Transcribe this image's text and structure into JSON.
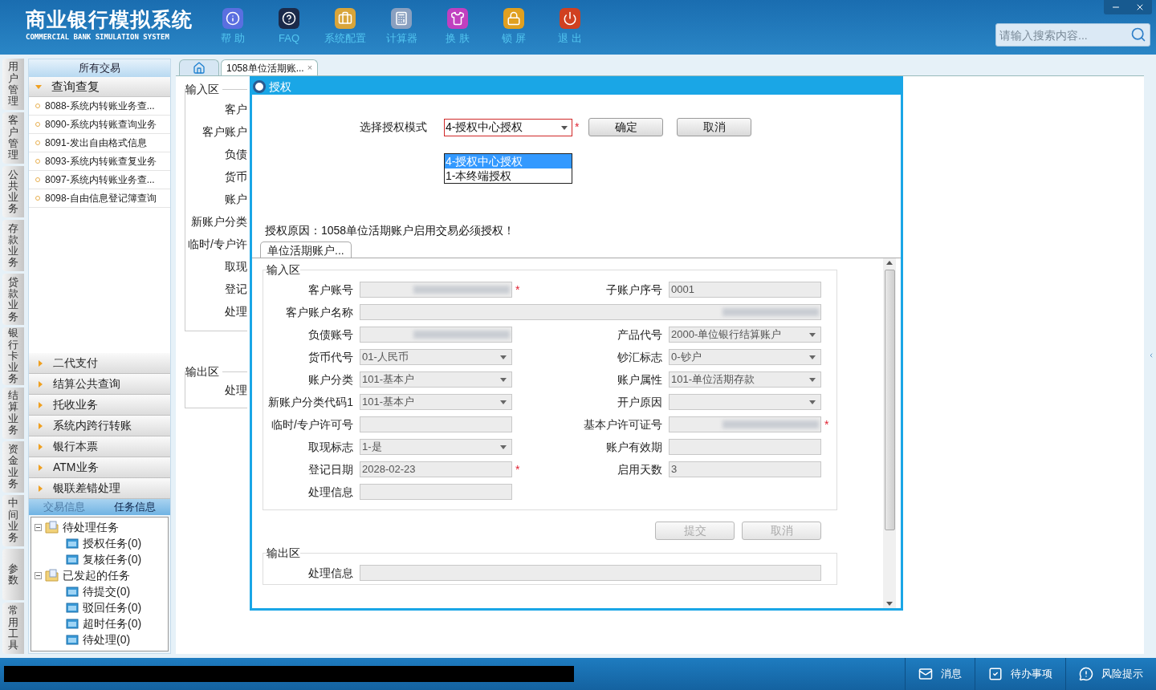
{
  "header": {
    "title": "商业银行模拟系统",
    "subtitle": "COMMERCIAL BANK SIMULATION SYSTEM",
    "toolbar": [
      {
        "kind": "help",
        "label": "帮 助"
      },
      {
        "kind": "faq",
        "label": "FAQ"
      },
      {
        "kind": "config",
        "label": "系统配置"
      },
      {
        "kind": "calculator",
        "label": "计算器"
      },
      {
        "kind": "skin",
        "label": "换 肤"
      },
      {
        "kind": "lock",
        "label": "锁 屏"
      },
      {
        "kind": "exit",
        "label": "退 出"
      }
    ],
    "search": {
      "placeholder": "请输入搜索内容..."
    }
  },
  "nav_tabs": [
    "用户管理",
    "客户管理",
    "公共业务",
    "存款业务",
    "贷款业务",
    "银行卡业务",
    "结算业务",
    "资金业务",
    "中间业务",
    "参数",
    "常用工具"
  ],
  "sidebar": {
    "title": "所有交易",
    "groups": [
      {
        "label": "查询查复",
        "expanded": true,
        "items": [
          "8088-系统内转账业务查...",
          "8090-系统内转账查询业务",
          "8091-发出自由格式信息",
          "8093-系统内转账查复业务",
          "8097-系统内转账业务查...",
          "8098-自由信息登记簿查询"
        ]
      },
      {
        "label": "二代支付",
        "expanded": false
      },
      {
        "label": "结算公共查询",
        "expanded": false
      },
      {
        "label": "托收业务",
        "expanded": false
      },
      {
        "label": "系统内跨行转账",
        "expanded": false
      },
      {
        "label": "银行本票",
        "expanded": false
      },
      {
        "label": "ATM业务",
        "expanded": false
      },
      {
        "label": "银联差错处理",
        "expanded": false
      }
    ],
    "bottom_tabs": [
      {
        "label": "交易信息",
        "selected": false
      },
      {
        "label": "任务信息",
        "selected": true
      }
    ],
    "tree": [
      {
        "label": "待处理任务",
        "expanded": true,
        "children": [
          {
            "label": "授权任务(0)"
          },
          {
            "label": "复核任务(0)"
          }
        ]
      },
      {
        "label": "已发起的任务",
        "expanded": true,
        "children": [
          {
            "label": "待提交(0)"
          },
          {
            "label": "驳回任务(0)"
          },
          {
            "label": "超时任务(0)"
          },
          {
            "label": "待处理(0)"
          }
        ]
      }
    ]
  },
  "tabs": [
    {
      "kind": "home",
      "selected": false
    },
    {
      "kind": "page",
      "label": "1058单位活期账...",
      "close": "×",
      "selected": true
    }
  ],
  "background_form": {
    "input_legend": "输入区",
    "input_labels": [
      "客户",
      "客户账户",
      "负债",
      "货币",
      "账户",
      "新账户分类",
      "临时/专户许",
      "取现",
      "登记",
      "处理"
    ],
    "output_legend": "输出区",
    "output_labels": [
      "处理"
    ]
  },
  "dialog": {
    "title": "授权",
    "mode_label": "选择授权模式",
    "mode_select": {
      "value": "4-授权中心授权",
      "mark": "*",
      "expanded": true,
      "options": [
        {
          "label": "4-授权中心授权",
          "selected": true
        },
        {
          "label": "1-本终端授权",
          "selected": false
        }
      ]
    },
    "buttons": [
      "确定",
      "取消"
    ],
    "reason": "授权原因：1058单位活期账户启用交易必须授权！",
    "tab": "单位活期账户...",
    "input_legend": "输入区",
    "rows": [
      {
        "left": {
          "label": "客户账号",
          "kind": "text",
          "blurred": true,
          "mark": "*"
        },
        "right": {
          "label": "子账户序号",
          "kind": "text",
          "value": "0001"
        }
      },
      {
        "left": {
          "label": "客户账户名称",
          "kind": "wide",
          "blurred": true
        }
      },
      {
        "left": {
          "label": "负债账号",
          "kind": "text",
          "blurred": true
        },
        "right": {
          "label": "产品代号",
          "kind": "select",
          "value": "2000-单位银行结算账户"
        }
      },
      {
        "left": {
          "label": "货币代号",
          "kind": "select",
          "value": "01-人民币"
        },
        "right": {
          "label": "钞汇标志",
          "kind": "select",
          "value": "0-钞户"
        }
      },
      {
        "left": {
          "label": "账户分类",
          "kind": "select",
          "value": "101-基本户"
        },
        "right": {
          "label": "账户属性",
          "kind": "select",
          "value": "101-单位活期存款"
        }
      },
      {
        "left": {
          "label": "新账户分类代码1",
          "kind": "select",
          "value": "101-基本户"
        },
        "right": {
          "label": "开户原因",
          "kind": "select"
        }
      },
      {
        "left": {
          "label": "临时/专户许可号",
          "kind": "text"
        },
        "right": {
          "label": "基本户许可证号",
          "kind": "text",
          "blurred": true,
          "mark": "*"
        }
      },
      {
        "left": {
          "label": "取现标志",
          "kind": "select",
          "value": "1-是"
        },
        "right": {
          "label": "账户有效期",
          "kind": "text"
        }
      },
      {
        "left": {
          "label": "登记日期",
          "kind": "text",
          "value": "2028-02-23",
          "mark": "*"
        },
        "right": {
          "label": "启用天数",
          "kind": "text",
          "value": "3"
        }
      },
      {
        "left": {
          "label": "处理信息",
          "kind": "text"
        }
      }
    ],
    "actions": [
      {
        "label": "提交",
        "disabled": true
      },
      {
        "label": "取消",
        "disabled": true
      }
    ],
    "output_legend": "输出区",
    "output_fields": [
      {
        "label": "处理信息",
        "kind": "wide"
      }
    ]
  },
  "status_bar": {
    "items": [
      {
        "kind": "message",
        "label": "消息"
      },
      {
        "kind": "todo",
        "label": "待办事项"
      },
      {
        "kind": "risk",
        "label": "风险提示"
      }
    ]
  }
}
